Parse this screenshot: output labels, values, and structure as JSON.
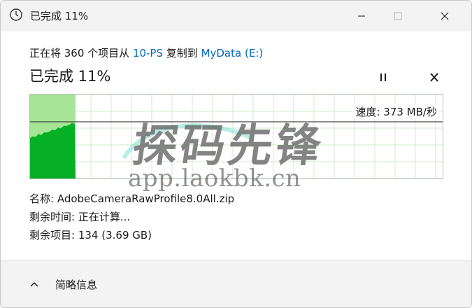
{
  "window": {
    "title": "已完成 11%",
    "icon": "clock-icon"
  },
  "summary": {
    "prefix": "正在将 360 个项目从 ",
    "source": "10-PS",
    "middle": " 复制到 ",
    "destination": "MyData (E:)"
  },
  "progress": {
    "heading": "已完成 11%",
    "percent": 11,
    "speed_label": "速度: 373 MB/秒",
    "pause_icon": "pause-icon",
    "stop_icon": "close-icon"
  },
  "details": {
    "name_label": "名称:",
    "name_value": "AdobeCameraRawProfile8.0All.zip",
    "time_label": "剩余时间:",
    "time_value": "正在计算...",
    "items_label": "剩余项目:",
    "items_value": "134 (3.69 GB)"
  },
  "footer": {
    "label": "简略信息",
    "icon": "chevron-up-icon"
  },
  "watermark": {
    "cjk": "探码先锋",
    "url": "app.laokbk.cn"
  },
  "colors": {
    "link": "#0067c0",
    "graph_fill": "#06b025",
    "graph_done_bg": "#a6e597",
    "graph_grid": "#cfeccb"
  }
}
